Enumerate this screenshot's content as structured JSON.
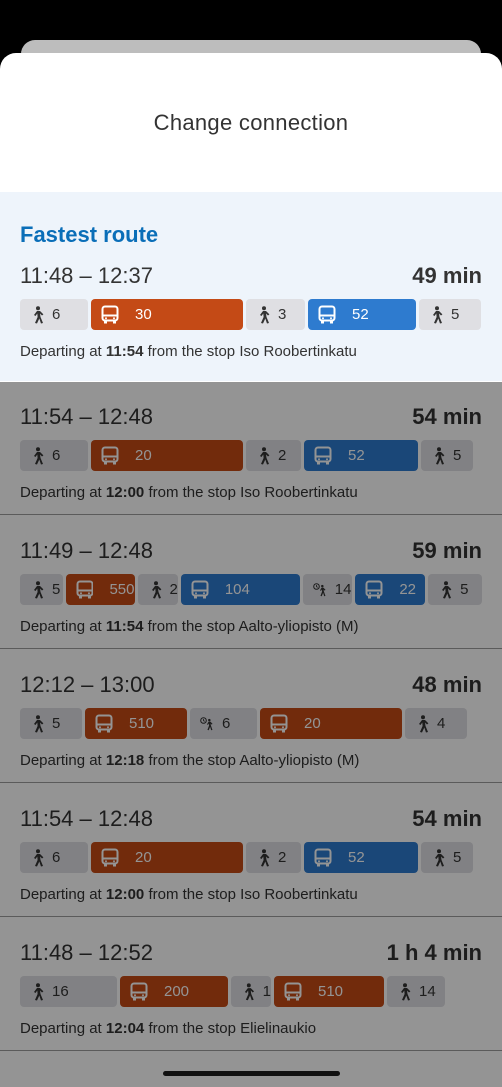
{
  "header": {
    "title": "Change connection"
  },
  "fastest_label": "Fastest route",
  "depart_prefix": "Departing at",
  "depart_middle": "from the stop",
  "routes": [
    {
      "times": "11:48 – 12:37",
      "duration": "49 min",
      "depart_time": "11:54",
      "stop": "Iso Roobertinkatu",
      "legs": [
        {
          "type": "walk",
          "value": "6"
        },
        {
          "type": "bus-orange",
          "value": "30"
        },
        {
          "type": "walk",
          "value": "3"
        },
        {
          "type": "bus-blue",
          "value": "52"
        },
        {
          "type": "walk",
          "value": "5"
        }
      ]
    },
    {
      "times": "11:54 – 12:48",
      "duration": "54 min",
      "depart_time": "12:00",
      "stop": "Iso Roobertinkatu",
      "legs": [
        {
          "type": "walk",
          "value": "6"
        },
        {
          "type": "bus-orange",
          "value": "20"
        },
        {
          "type": "walk",
          "value": "2"
        },
        {
          "type": "bus-blue",
          "value": "52"
        },
        {
          "type": "walk",
          "value": "5"
        }
      ]
    },
    {
      "times": "11:49 – 12:48",
      "duration": "59 min",
      "depart_time": "11:54",
      "stop": "Aalto-yliopisto (M)",
      "legs": [
        {
          "type": "walk",
          "value": "5"
        },
        {
          "type": "bus-orange",
          "value": "550"
        },
        {
          "type": "walk",
          "value": "2"
        },
        {
          "type": "bus-blue",
          "value": "104"
        },
        {
          "type": "wait",
          "value": "14"
        },
        {
          "type": "bus-blue",
          "value": "22"
        },
        {
          "type": "walk",
          "value": "5"
        }
      ]
    },
    {
      "times": "12:12 – 13:00",
      "duration": "48 min",
      "depart_time": "12:18",
      "stop": "Aalto-yliopisto (M)",
      "legs": [
        {
          "type": "walk",
          "value": "5"
        },
        {
          "type": "bus-orange",
          "value": "510"
        },
        {
          "type": "wait",
          "value": "6"
        },
        {
          "type": "bus-orange",
          "value": "20"
        },
        {
          "type": "walk",
          "value": "4"
        }
      ]
    },
    {
      "times": "11:54 – 12:48",
      "duration": "54 min",
      "depart_time": "12:00",
      "stop": "Iso Roobertinkatu",
      "legs": [
        {
          "type": "walk",
          "value": "6"
        },
        {
          "type": "bus-orange",
          "value": "20"
        },
        {
          "type": "walk",
          "value": "2"
        },
        {
          "type": "bus-blue",
          "value": "52"
        },
        {
          "type": "walk",
          "value": "5"
        }
      ]
    },
    {
      "times": "11:48 – 12:52",
      "duration": "1 h 4 min",
      "depart_time": "12:04",
      "stop": "Elielinaukio",
      "legs": [
        {
          "type": "walk",
          "value": "16"
        },
        {
          "type": "bus-orange",
          "value": "200"
        },
        {
          "type": "walk",
          "value": "1"
        },
        {
          "type": "bus-orange",
          "value": "510"
        },
        {
          "type": "walk",
          "value": "14"
        }
      ]
    }
  ]
}
